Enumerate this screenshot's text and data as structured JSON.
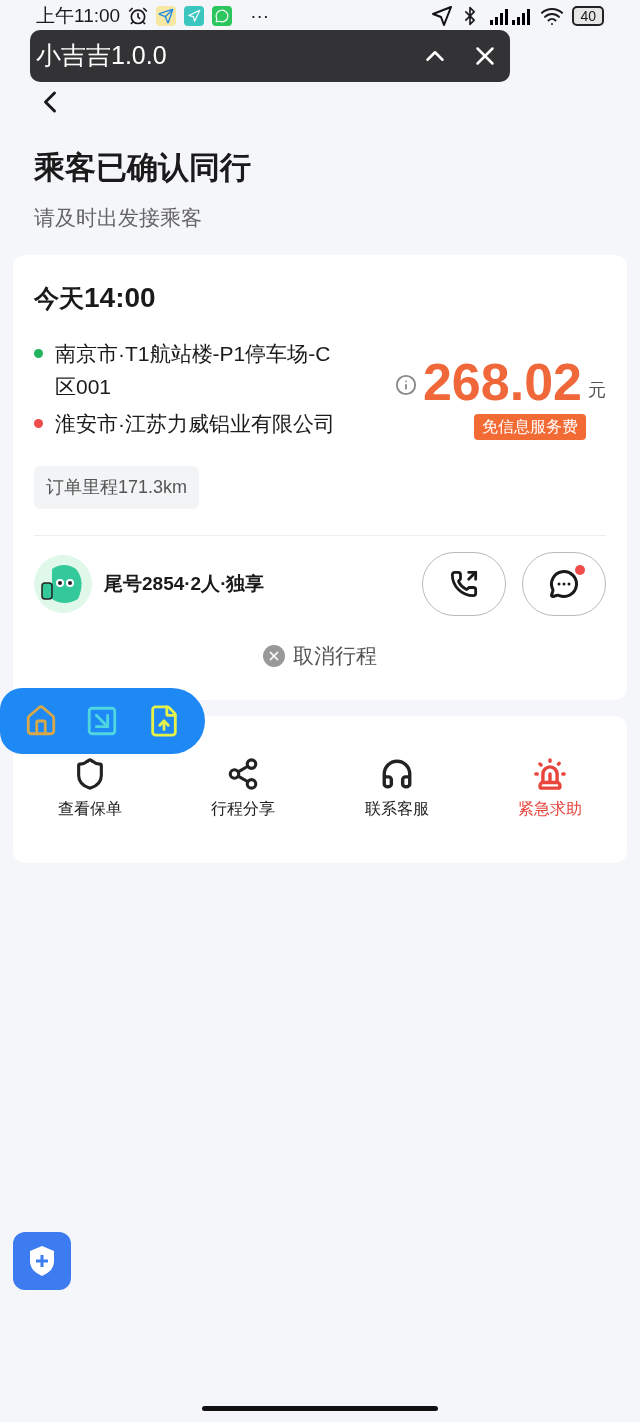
{
  "status_bar": {
    "time": "上午11:00",
    "more": "···",
    "battery": "40"
  },
  "overlay": {
    "title": "小吉吉1.0.0"
  },
  "header": {
    "title": "乘客已确认同行",
    "subtitle": "请及时出发接乘客"
  },
  "trip": {
    "day": "今天",
    "time": "14:00",
    "stops": [
      {
        "label": "南京市·T1航站楼-P1停车场-C区001",
        "color": "#22b35e"
      },
      {
        "label": "淮安市·江苏力威铝业有限公司",
        "color": "#f04c4c"
      }
    ],
    "price": "268.02",
    "unit": "元",
    "badge": "免信息服务费",
    "distance": "订单里程171.3km",
    "passenger": "尾号2854·2人·独享",
    "message_unread": true,
    "cancel": "取消行程"
  },
  "actions": [
    {
      "label": "查看保单",
      "kind": "insurance"
    },
    {
      "label": "行程分享",
      "kind": "share"
    },
    {
      "label": "联系客服",
      "kind": "service"
    },
    {
      "label": "紧急求助",
      "kind": "emergency"
    }
  ]
}
